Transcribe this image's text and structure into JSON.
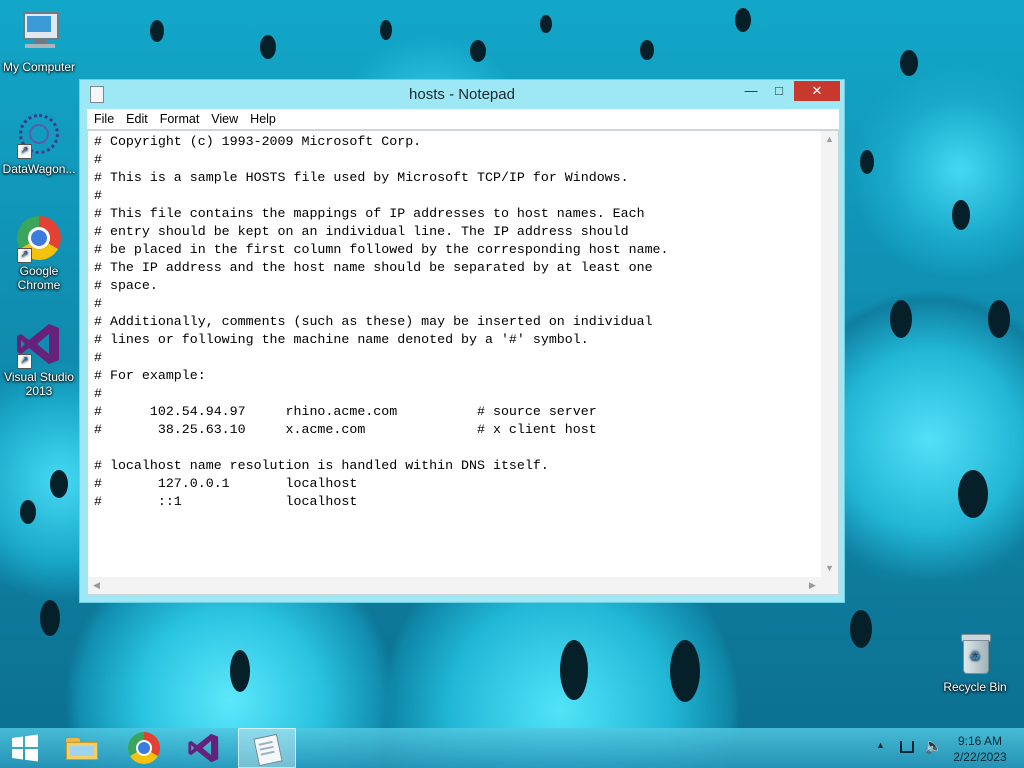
{
  "desktop": {
    "icons": [
      {
        "label": "My Computer"
      },
      {
        "label": "DataWagon..."
      },
      {
        "label": "Google Chrome"
      },
      {
        "label": "Visual Studio 2013"
      },
      {
        "label": "Recycle Bin"
      }
    ]
  },
  "window": {
    "title": "hosts - Notepad",
    "controls": {
      "minimize": "—",
      "maximize": "□",
      "close": "✕"
    },
    "menu": [
      "File",
      "Edit",
      "Format",
      "View",
      "Help"
    ],
    "content": "# Copyright (c) 1993-2009 Microsoft Corp.\n#\n# This is a sample HOSTS file used by Microsoft TCP/IP for Windows.\n#\n# This file contains the mappings of IP addresses to host names. Each\n# entry should be kept on an individual line. The IP address should\n# be placed in the first column followed by the corresponding host name.\n# The IP address and the host name should be separated by at least one\n# space.\n#\n# Additionally, comments (such as these) may be inserted on individual\n# lines or following the machine name denoted by a '#' symbol.\n#\n# For example:\n#\n#      102.54.94.97     rhino.acme.com          # source server\n#       38.25.63.10     x.acme.com              # x client host\n\n# localhost name resolution is handled within DNS itself.\n#\t127.0.0.1       localhost\n#\t::1             localhost"
  },
  "taskbar": {
    "buttons": [
      "start-button",
      "file-explorer",
      "google-chrome",
      "visual-studio",
      "notepad"
    ],
    "clock": {
      "time": "9:16 AM",
      "date": "2/22/2023"
    },
    "tray_icons": [
      "show-hidden-icons-arrow",
      "network-icon",
      "volume-icon"
    ]
  },
  "colors": {
    "close_button": "#c7392f",
    "window_frame": "#9ee7f4",
    "taskbar": "#38a9c8"
  }
}
